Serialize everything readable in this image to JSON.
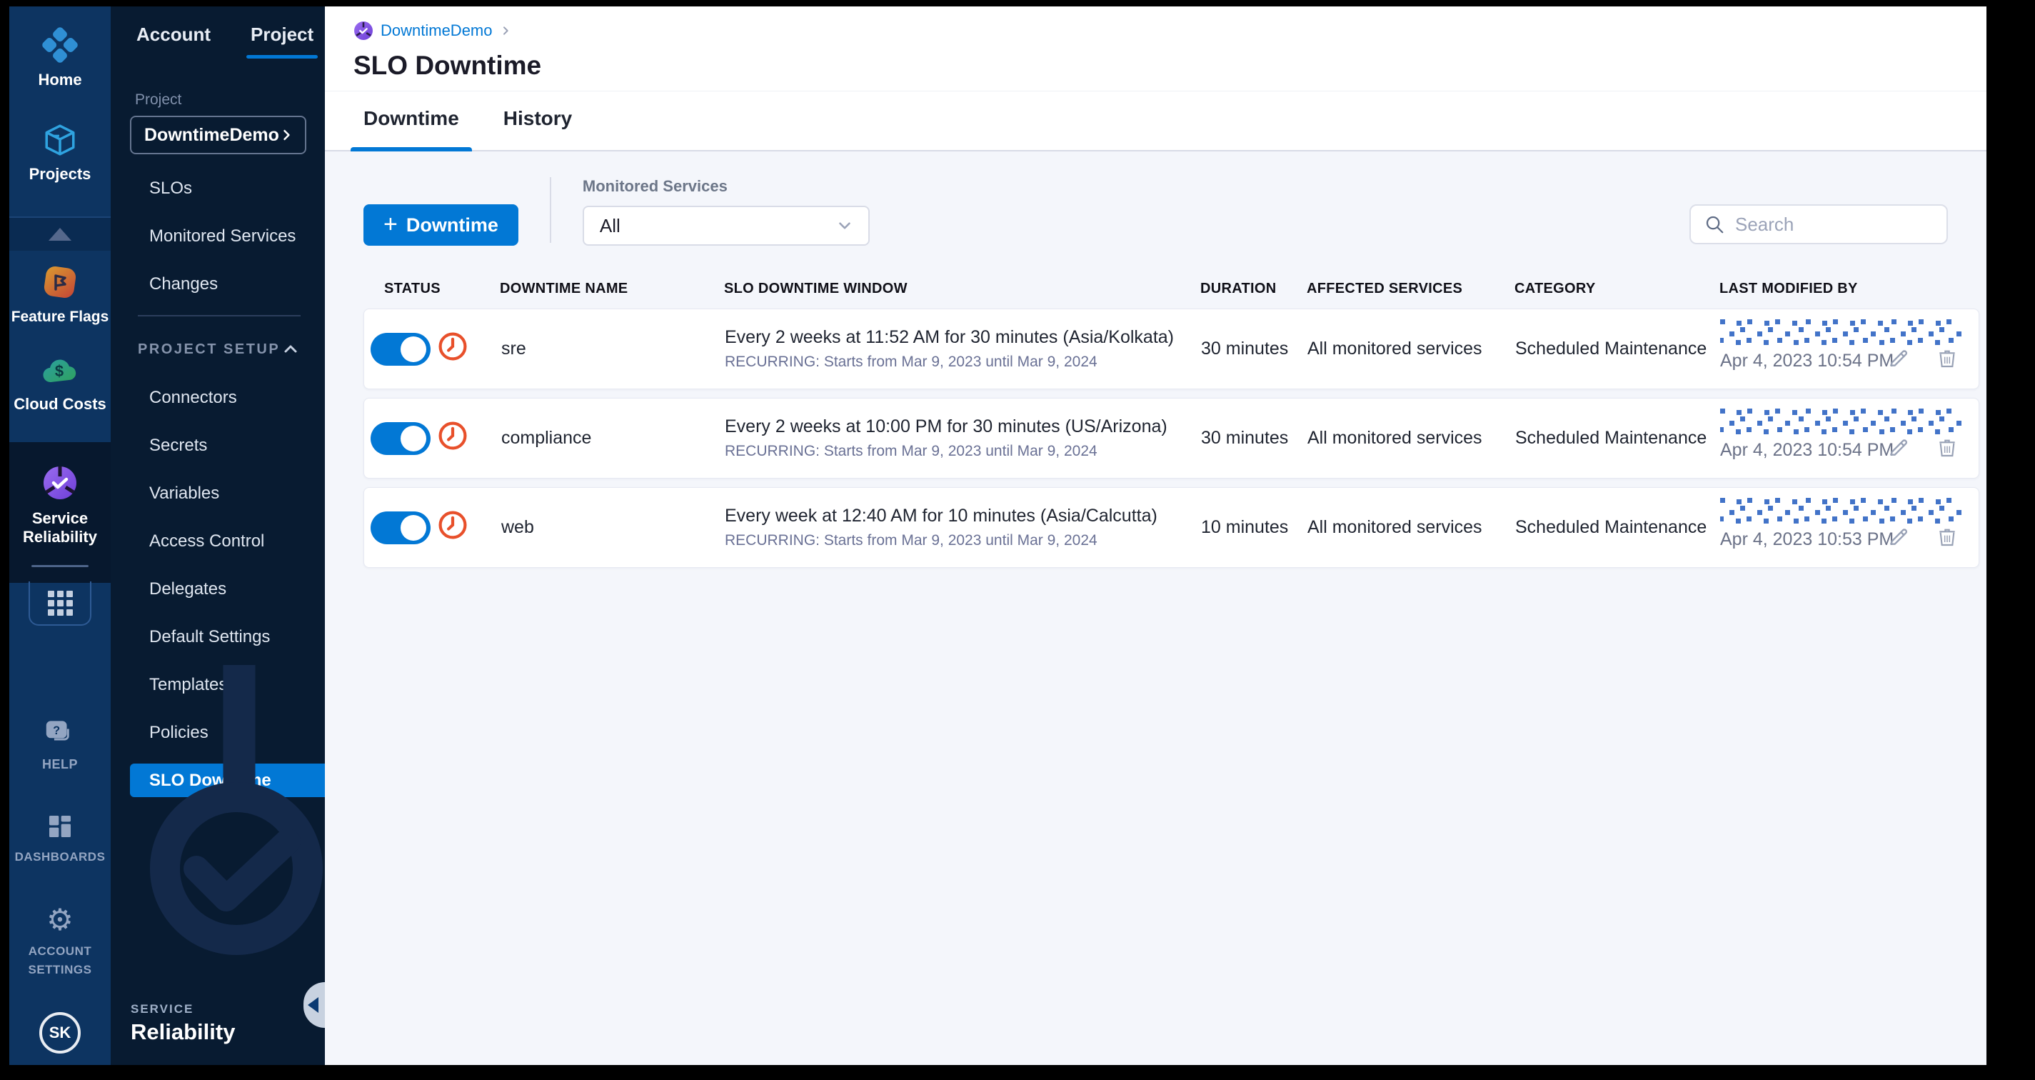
{
  "colors": {
    "accent": "#0278D5",
    "nav_dark": "#081B31",
    "rail_blue": "#0D3461",
    "clock_icon": "#E8502B",
    "scribble_dot": "#4273C8"
  },
  "rail": {
    "home": {
      "label": "Home"
    },
    "projects": {
      "label": "Projects"
    },
    "feature_flags": {
      "label": "Feature Flags"
    },
    "cloud_costs": {
      "label": "Cloud Costs"
    },
    "service_reliability": {
      "label": "Service Reliability"
    },
    "help": {
      "label": "HELP"
    },
    "dashboards": {
      "label": "DASHBOARDS"
    },
    "account_settings": {
      "label": "ACCOUNT SETTINGS"
    },
    "avatar_initials": "SK"
  },
  "subnav": {
    "tabs": {
      "account": "Account",
      "project": "Project"
    },
    "project_label": "Project",
    "project_selector": "DowntimeDemo",
    "items_top": [
      "SLOs",
      "Monitored Services",
      "Changes"
    ],
    "section_header": "PROJECT SETUP",
    "items_setup": [
      "Connectors",
      "Secrets",
      "Variables",
      "Access Control",
      "Delegates",
      "Default Settings",
      "Templates",
      "Policies",
      "SLO Downtime"
    ],
    "active_item": "SLO Downtime",
    "brand_top": "SERVICE",
    "brand_bottom": "Reliability"
  },
  "header": {
    "breadcrumb": "DowntimeDemo",
    "title": "SLO Downtime",
    "tabs": {
      "downtime": "Downtime",
      "history": "History"
    }
  },
  "toolbar": {
    "new_button": {
      "plus": "+",
      "label": "Downtime"
    },
    "filter_label": "Monitored Services",
    "filter_value": "All",
    "search_placeholder": "Search"
  },
  "table": {
    "columns": [
      "STATUS",
      "DOWNTIME NAME",
      "SLO DOWNTIME WINDOW",
      "DURATION",
      "AFFECTED SERVICES",
      "CATEGORY",
      "LAST MODIFIED BY"
    ],
    "rows": [
      {
        "status_on": true,
        "name": "sre",
        "window": "Every 2 weeks at 11:52 AM for 30 minutes (Asia/Kolkata)",
        "recurrence": "RECURRING: Starts from Mar 9, 2023 until Mar 9, 2024",
        "duration": "30 minutes",
        "affected": "All monitored services",
        "category": "Scheduled Maintenance",
        "modified": "Apr 4, 2023 10:54 PM"
      },
      {
        "status_on": true,
        "name": "compliance",
        "window": "Every 2 weeks at 10:00 PM for 30 minutes (US/Arizona)",
        "recurrence": "RECURRING: Starts from Mar 9, 2023 until Mar 9, 2024",
        "duration": "30 minutes",
        "affected": "All monitored services",
        "category": "Scheduled Maintenance",
        "modified": "Apr 4, 2023 10:54 PM"
      },
      {
        "status_on": true,
        "name": "web",
        "window": "Every week at 12:40 AM for 10 minutes (Asia/Calcutta)",
        "recurrence": "RECURRING: Starts from Mar 9, 2023 until Mar 9, 2024",
        "duration": "10 minutes",
        "affected": "All monitored services",
        "category": "Scheduled Maintenance",
        "modified": "Apr 4, 2023 10:53 PM"
      }
    ]
  }
}
